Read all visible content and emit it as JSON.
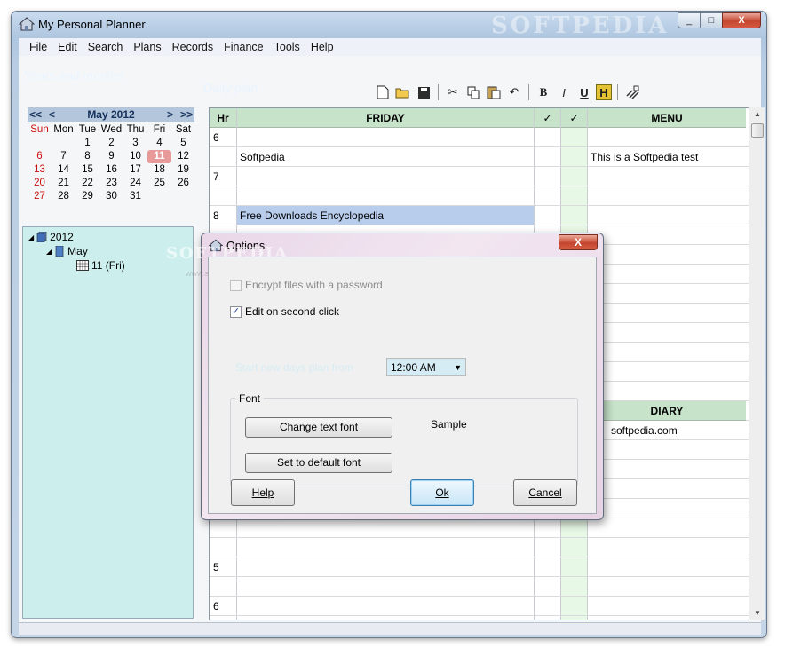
{
  "window": {
    "title": "My Personal Planner",
    "watermark": "SOFTPEDIA"
  },
  "caption": {
    "minimize": "_",
    "maximize": "□",
    "close": "X"
  },
  "menu": [
    "File",
    "Edit",
    "Search",
    "Plans",
    "Records",
    "Finance",
    "Tools",
    "Help"
  ],
  "left": {
    "header": "Years and months",
    "calendar": {
      "prev_year": "<<",
      "prev_month": "<",
      "month_label": "May 2012",
      "next_month": ">",
      "next_year": ">>",
      "weekdays": [
        "Sun",
        "Mon",
        "Tue",
        "Wed",
        "Thu",
        "Fri",
        "Sat"
      ],
      "weeks": [
        [
          "",
          "",
          "1",
          "2",
          "3",
          "4",
          "5"
        ],
        [
          "6",
          "7",
          "8",
          "9",
          "10",
          "11",
          "12"
        ],
        [
          "13",
          "14",
          "15",
          "16",
          "17",
          "18",
          "19"
        ],
        [
          "20",
          "21",
          "22",
          "23",
          "24",
          "25",
          "26"
        ],
        [
          "27",
          "28",
          "29",
          "30",
          "31",
          "",
          ""
        ]
      ],
      "today": "11"
    },
    "tree": {
      "year": "2012",
      "month": "May",
      "day": "11 (Fri)"
    }
  },
  "right": {
    "header": "Daily plan",
    "toolbar": {
      "bold": "B",
      "italic": "I",
      "underline": "U",
      "highlight": "H"
    },
    "columns": {
      "hr": "Hr",
      "day": "FRIDAY",
      "check1": "✓",
      "check2": "✓",
      "menu": "MENU",
      "diary": "DIARY"
    },
    "hours": [
      "6",
      "7",
      "8",
      "5",
      "6"
    ],
    "entries": {
      "softpedia": "Softpedia",
      "menu_test": "This is a Softpedia test",
      "downloads": "Free Downloads Encyclopedia",
      "diary_entry": "softpedia.com"
    }
  },
  "dialog": {
    "title": "Options",
    "watermark": "SOFTPEDIA",
    "watermark_url": "www.softpedia.com",
    "close": "X",
    "encrypt_label": "Encrypt files with a password",
    "edit_label": "Edit on second click",
    "time_label": "Start new days plan from",
    "time_value": "12:00 AM",
    "font_group": "Font",
    "change_font": "Change text font",
    "default_font": "Set to default font",
    "sample": "Sample",
    "help": "Help",
    "ok": "Ok",
    "cancel": "Cancel"
  }
}
